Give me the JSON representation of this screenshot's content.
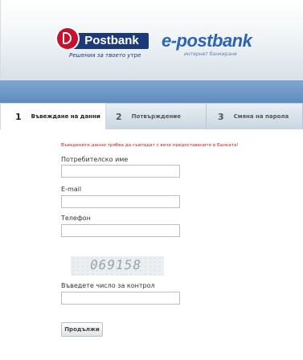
{
  "header": {
    "postbank": {
      "name": "Postbank",
      "tagline": "Решения за твоето утре"
    },
    "epostbank": {
      "name": "e-postbank",
      "tagline": "интернет банкиране"
    }
  },
  "tabs": [
    {
      "number": "1",
      "label": "Въвеждане на данни",
      "active": true
    },
    {
      "number": "2",
      "label": "Потвърждение",
      "active": false
    },
    {
      "number": "3",
      "label": "Смяна на парола",
      "active": false
    }
  ],
  "form": {
    "notice": "Въведените данни трябва да съвпадат с вече предоставените в Банката!",
    "fields": {
      "username": {
        "label": "Потребителско име",
        "value": ""
      },
      "email": {
        "label": "E-mail",
        "value": ""
      },
      "phone": {
        "label": "Телефон",
        "value": ""
      },
      "captcha": {
        "label": "Въведете число за контрол",
        "value": ""
      }
    },
    "captcha_code": "069158",
    "submit_label": "Продължи"
  },
  "colors": {
    "accent_red": "#c8102e",
    "brand_blue": "#1d3a78",
    "band_blue": "#6b96c4",
    "notice_red": "#d61a1a"
  }
}
